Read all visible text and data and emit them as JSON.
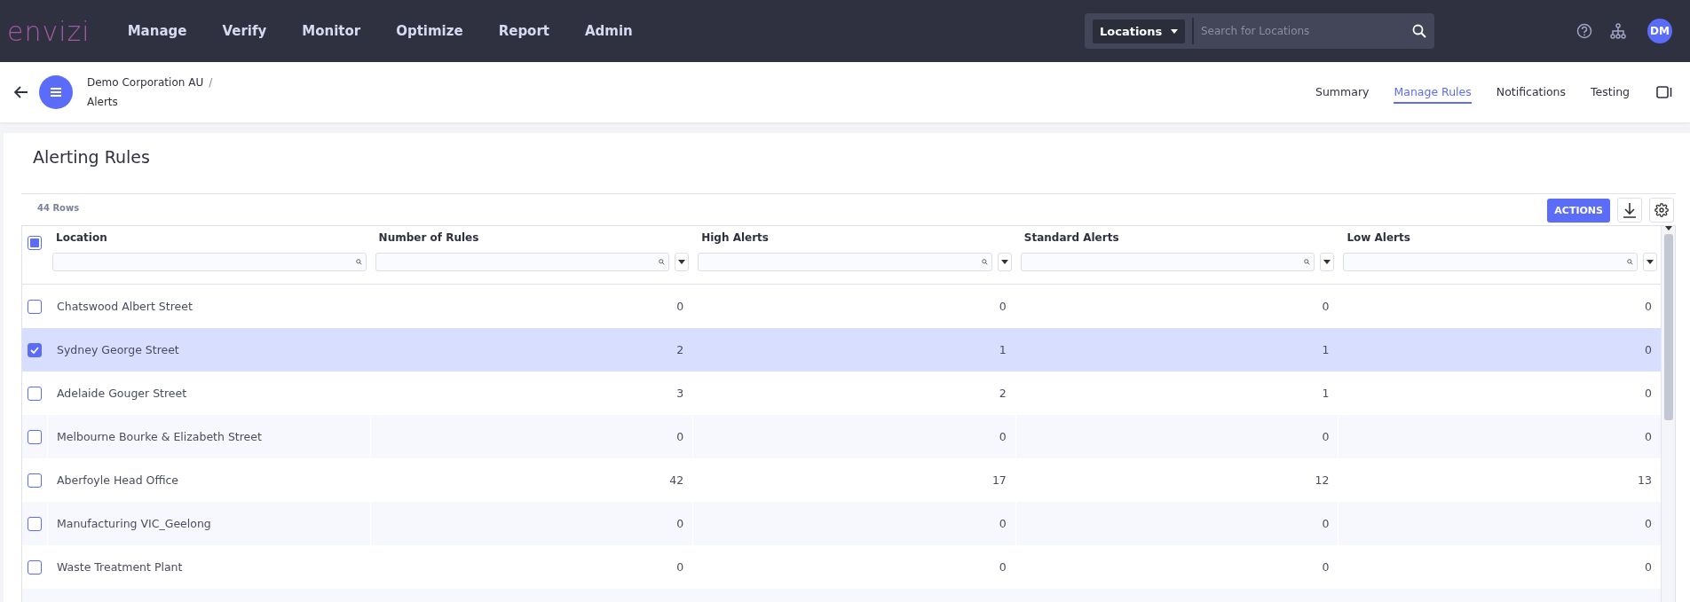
{
  "topbar": {
    "logo": "envizi",
    "nav": [
      {
        "label": "Manage"
      },
      {
        "label": "Verify"
      },
      {
        "label": "Monitor"
      },
      {
        "label": "Optimize"
      },
      {
        "label": "Report"
      },
      {
        "label": "Admin"
      }
    ],
    "search": {
      "scope": "Locations",
      "placeholder": "Search for Locations"
    },
    "avatar": "DM"
  },
  "subheader": {
    "breadcrumb": "Demo Corporation AU",
    "separator": "/",
    "page": "Alerts",
    "tabs": [
      {
        "label": "Summary",
        "selected": false
      },
      {
        "label": "Manage Rules",
        "selected": true
      },
      {
        "label": "Notifications",
        "selected": false
      },
      {
        "label": "Testing",
        "selected": false
      }
    ]
  },
  "panel": {
    "title": "Alerting Rules",
    "row_count": "44 Rows",
    "actions_button": "ACTIONS"
  },
  "table": {
    "select_all": {
      "checked": true,
      "indeterminate": true
    },
    "columns": [
      {
        "label": "Location",
        "kind": "text"
      },
      {
        "label": "Number of Rules",
        "kind": "number"
      },
      {
        "label": "High Alerts",
        "kind": "number"
      },
      {
        "label": "Standard Alerts",
        "kind": "number"
      },
      {
        "label": "Low Alerts",
        "kind": "number"
      }
    ],
    "rows": [
      {
        "selected": false,
        "cells": [
          "Chatswood Albert Street",
          "0",
          "0",
          "0",
          "0"
        ]
      },
      {
        "selected": true,
        "cells": [
          "Sydney George Street",
          "2",
          "1",
          "1",
          "0"
        ]
      },
      {
        "selected": false,
        "cells": [
          "Adelaide Gouger Street",
          "3",
          "2",
          "1",
          "0"
        ]
      },
      {
        "selected": false,
        "cells": [
          "Melbourne Bourke & Elizabeth Street",
          "0",
          "0",
          "0",
          "0"
        ]
      },
      {
        "selected": false,
        "cells": [
          "Aberfoyle Head Office",
          "42",
          "17",
          "12",
          "13"
        ]
      },
      {
        "selected": false,
        "cells": [
          "Manufacturing VIC_Geelong",
          "0",
          "0",
          "0",
          "0"
        ]
      },
      {
        "selected": false,
        "cells": [
          "Waste Treatment Plant",
          "0",
          "0",
          "0",
          "0"
        ]
      }
    ]
  }
}
